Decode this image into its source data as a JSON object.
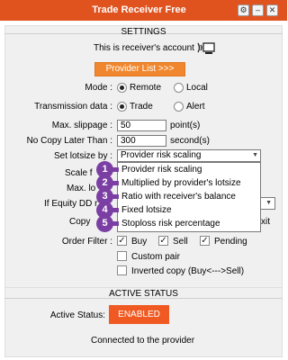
{
  "window": {
    "title": "Trade Receiver Free",
    "buttons": [
      "gear-icon",
      "minimize-icon",
      "close-icon"
    ]
  },
  "settings": {
    "section_title": "SETTINGS",
    "account_text": "This is receiver's account",
    "provider_list_button": "Provider List >>>",
    "mode": {
      "label": "Mode :",
      "options": [
        "Remote",
        "Local"
      ],
      "selected": "Remote"
    },
    "transmission": {
      "label": "Transmission data :",
      "options": [
        "Trade",
        "Alert"
      ],
      "selected": "Trade"
    },
    "max_slippage": {
      "label": "Max. slippage :",
      "value": "50",
      "unit": "point(s)"
    },
    "no_copy_later": {
      "label": "No Copy Later Than :",
      "value": "300",
      "unit": "second(s)"
    },
    "lotsize": {
      "label": "Set lotsize by :",
      "value": "Provider risk scaling"
    },
    "partial_labels": {
      "scale": "Scale f",
      "max_lot": "Max. lo",
      "equity_dd": "If Equity DD r",
      "copy": "Copy",
      "copy_tail": "xit"
    },
    "dropdown_options": [
      "Provider risk scaling",
      "Multiplied by provider's lotsize",
      "Ratio with receiver's balance",
      "Fixed lotsize",
      "Stoploss risk percentage"
    ],
    "badges": [
      "1",
      "2",
      "3",
      "4",
      "5"
    ],
    "order_filter": {
      "label": "Order Filter :",
      "buy": "Buy",
      "sell": "Sell",
      "pending": "Pending",
      "custom_pair": "Custom pair",
      "inverted_copy": "Inverted copy (Buy<--->Sell)"
    }
  },
  "active_status": {
    "section_title": "ACTIVE STATUS",
    "label": "Active Status:",
    "button": "ENABLED",
    "message": "Connected to the provider"
  },
  "colors": {
    "accent": "#e0531f",
    "orange_button": "#f0872e",
    "enabled": "#f05a22",
    "badge": "#7b3fa4"
  }
}
